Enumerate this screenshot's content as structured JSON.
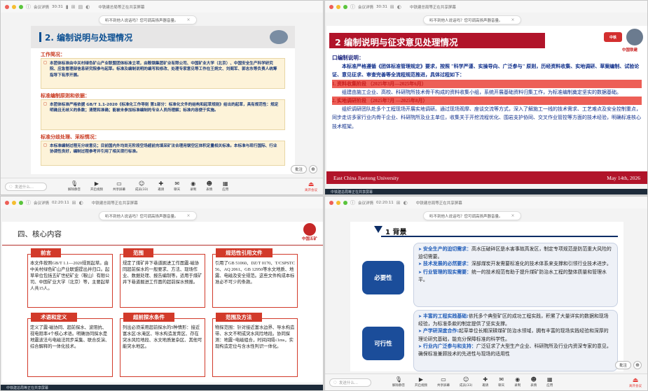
{
  "common": {
    "meeting_info": "会议详情",
    "signal": "",
    "toast": "听不到他人说话吗？您可调高扬声器音量。",
    "toast_close": "×",
    "search_placeholder": "发送什么...",
    "bottom_items": [
      "解除静音",
      "开启视频",
      "共享屏幕",
      "成员(33)",
      "邀请",
      "聊天",
      "录制",
      "表情",
      "应用",
      "更多"
    ],
    "leave_label": "离开会议",
    "annotate_label": "批注",
    "chip_label": "中铁建总局等正在共享屏幕"
  },
  "q1": {
    "time": "30:31",
    "slide_title": "2. 编制说明与处理情况",
    "sections": [
      {
        "title": "工作简况：",
        "text": "本团体标准由中关村绿色矿山产业联盟团体标准立项，由鞍钢集团矿业有限公司、中国矿业大学（北京）、中国安全生产科学研究院、应急管理部信息研究院参与起草。标准及编制说明的编写和修改、处理专家意见等工作在王炳文、刘阁军、郭志东等负责人统筹指导下有序开展。"
      },
      {
        "title": "标准编制原则和依据：",
        "text": "本团体标准严格依据 GB/T 1.1-2020《标准化工作导则 第1部分：标准化文件的结构和起草规则》给出的起草，具有规范性：规定明确且无歧义的条款；清楚和准确；能被未参加标准编制的专业人员所理解；标准内容便于实施。"
      },
      {
        "title": "标准分歧处理、采标情况：",
        "text": "本标准编制过程无分歧意见；目前国内外均尚无阶段空场超前充填采矿法合理用钢空区体积定量相关标准。本标准与现行国际、行业协调性良好，编制过程参考并引用了相关现行标准。"
      }
    ]
  },
  "q2": {
    "time": "30:31",
    "slide_title": "2 编制说明与征求意见处理情况",
    "logo_text": "中铁",
    "corner_text": "中国铁建",
    "heading": "口编制说明：",
    "intro": "本标准严格遵循《团体标准管理规定》要求，按照 \"科学严谨、实操导向、广泛参与\" 原则，历经资料收集、实地调研、草案编制、试验论证、意见征求、审查完善等全流程规范推进，具体过程如下：",
    "stage1_title": "1. 资料收集阶段 （2025年3月—2025年6月）",
    "stage1_text": "组建由施工企业、高校、科研院所技术骨干构成的资料收集小组，系统开展基础资料归集工作，为标准编制奠定坚实的数据基础。",
    "stage2_title": "2. 实地调研阶段 （2025年7月 —2025年8月）",
    "stage2_text": "组织调研团队赴多个工程现场开展实地调研。通过现场观摩、座谈交流等方式，深入了解施工一线的技术需求、工艺难点及安全控制重点，同步走访多家行业内骨干企业、科研院所及业主单位，收集关于开挖流程优化、围岩支护协同、交叉作业管控等方面的技术经验，明确标准核心技术框架。",
    "footer_left": "East China Jiaotong University",
    "footer_right": "May 14th, 2026"
  },
  "q3": {
    "time": "02:20:11",
    "slide_title": "四、核心内容",
    "logo_text": "中国五矿",
    "cards": [
      {
        "label": "前言",
        "text": "本文件按照GB/T 1.1—2020规则起草。由中关村绿色矿山产业联盟提出并归口。起草单位包括五矿世纪矿业（鞍山）有限公司、中国矿业大学（北京）等，主要起草人共15人。"
      },
      {
        "label": "范围",
        "text": "规定了煤矿井下巷道掘进工作面震-磁协同超前探水的一般要求、方法、现场作业、数据处理、报告编制等。适用于煤矿井下巷道掘进工作面的超前探水预报。"
      },
      {
        "label": "规范性引用文件",
        "text": "引用了GB 51060、DZ/T 0170、T/CSPSTC 56、AQ 2061、GB 12950等水文地质、地震、电磁及安全规范。这些文件构成本标准必不可少的条款。"
      },
      {
        "label": "术语和定义",
        "text": "定义了震-磁协同、超前探水、波阻抗、视电阻率4个核心术语。明确协同探水是地震波法与电磁法同步采集、联合反演、综合解释的一体化技术。"
      },
      {
        "label": "超前探水条件",
        "text": "列出必须采用超前探水的5种情形：接近富水区/水淹区、导水构造发育区、存在突水风险地段、水文地质复杂区、其他可能突水地区。"
      },
      {
        "label": "范围及方法",
        "text": "物探范围：针对接近富水边界、导水构造带、水文不明或突水风险地段。协同探测：地震+电磁组合，时间间隔≤1ms，实现构造定位与含水性判识一体化。"
      }
    ]
  },
  "q4": {
    "time": "02:20:11",
    "slide_title": "1 背景",
    "block1_label": "必要性",
    "block1_items": [
      {
        "head": "安全生产的迫切需求：",
        "text": "高水压破碎区是水害事故高发区，制定专项规范是防范重大风险的迫切需要。"
      },
      {
        "head": "技术发展的必然要求：",
        "text": "深部煤炭开发需要标准化的技术体系来支撑和引领行业技术进步。"
      },
      {
        "head": "行业管理的现实需要：",
        "text": "统一的技术规范有助于提升煤矿防治水工程的整体质量和管理水平。"
      }
    ],
    "block2_label": "可行性",
    "block2_items": [
      {
        "head": "丰富的工程实践基础:",
        "text": "依托多个典型矿区的成功工程实践，积累了大量详实的数据和现场经验，为标准条款的制定提供了坚实支撑。"
      },
      {
        "head": "产学研深度合作:",
        "text": "起草单位长期深耕煤矿防治水领域，拥有丰富的现场实践经验和深厚的理论研究基础，能充分保障标准的科学性。"
      },
      {
        "head": "行业内广泛参与和支持：",
        "text": "广泛征求了大型生产企业、科研院所及行业内资深专家的意见，确保标准兼顾技术的先进性与现场的适用性"
      }
    ]
  },
  "colors": {
    "accent_blue": "#0b4f92",
    "accent_red": "#b1142a",
    "leave_red": "#e53935"
  }
}
